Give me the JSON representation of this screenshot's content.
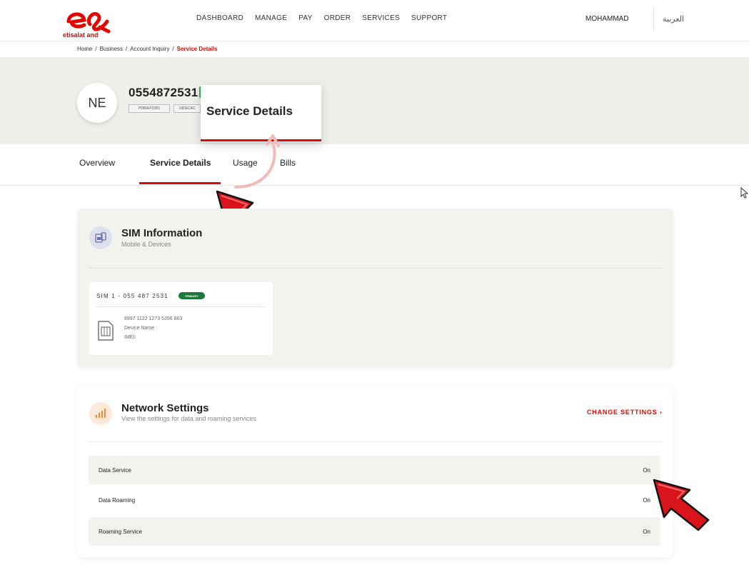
{
  "header": {
    "logo_text": "etisalat and",
    "nav": [
      "DASHBOARD",
      "MANAGE",
      "PAY",
      "ORDER",
      "SERVICES",
      "SUPPORT"
    ],
    "user": "MOHAMMAD",
    "language": "العربية",
    "brand_color": "#e00800"
  },
  "breadcrumb": {
    "items": [
      "Home",
      "Business",
      "Account Inquiry"
    ],
    "separator": "/",
    "current": "Service Details"
  },
  "profile": {
    "initials": "NE",
    "number": "0554872531",
    "tags": [
      "P5B5EP22B1",
      "19DECAC"
    ]
  },
  "tabs": {
    "items": [
      "Overview",
      "Service Details",
      "Usage",
      "Bills"
    ],
    "active": "Service Details"
  },
  "zoom_callout": {
    "label": "Service Details"
  },
  "sim_section": {
    "title": "SIM Information",
    "subtitle": "Mobile & Devices",
    "icon": "sim-devices-icon",
    "sim": {
      "title": "SIM 1 - 055 487 2531",
      "badge": "PRIMARY",
      "iccid": "8997 1122 1273 5356 863",
      "device_label": "Device Name :",
      "imei_label": "IMEI:"
    }
  },
  "network_section": {
    "title": "Network Settings",
    "subtitle": "View the settings for data and roaming services",
    "icon": "signal-bars-icon",
    "change_link": "CHANGE SETTINGS",
    "rows": [
      {
        "label": "Data Service",
        "value": "On"
      },
      {
        "label": "Data Roaming",
        "value": "On"
      },
      {
        "label": "Roaming Service",
        "value": "On"
      }
    ]
  },
  "colors": {
    "accent": "#e00800",
    "primary_badge": "#1b7a3c",
    "banner": "#efefeb",
    "card": "#f2f2ee"
  }
}
